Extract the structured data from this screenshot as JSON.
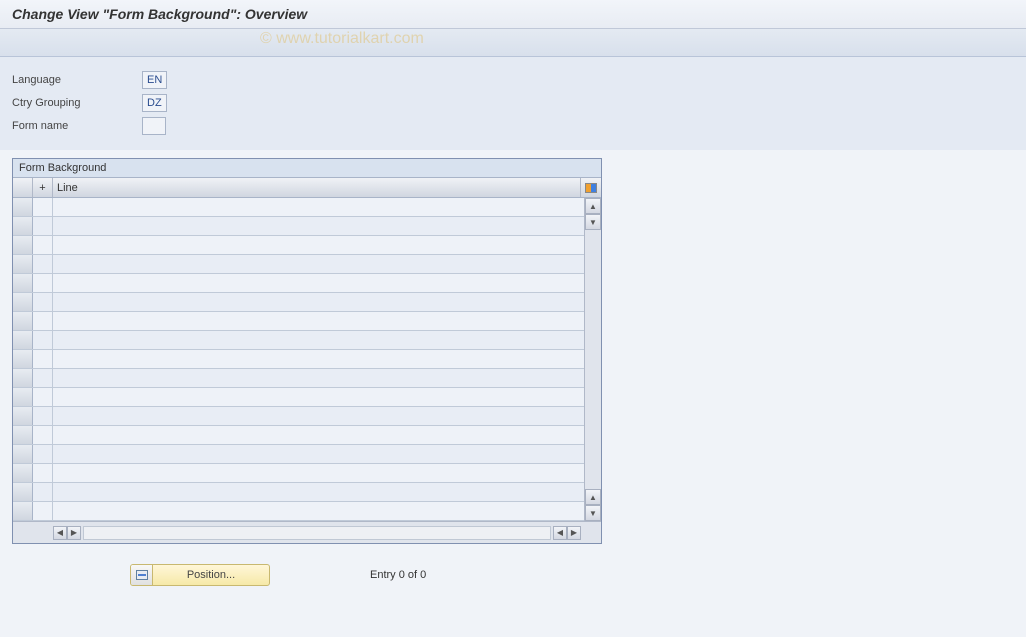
{
  "title": "Change View \"Form Background\": Overview",
  "watermark": "© www.tutorialkart.com",
  "fields": {
    "language_label": "Language",
    "language_value": "EN",
    "ctry_label": "Ctry Grouping",
    "ctry_value": "DZ",
    "formname_label": "Form name",
    "formname_value": ""
  },
  "table": {
    "title": "Form Background",
    "col_plus": "+",
    "col_line": "Line",
    "rows": [
      "",
      "",
      "",
      "",
      "",
      "",
      "",
      "",
      "",
      "",
      "",
      "",
      "",
      "",
      "",
      "",
      ""
    ]
  },
  "position_button": "Position...",
  "entry_status": "Entry 0 of 0",
  "icons": {
    "up": "▲",
    "down": "▼",
    "left": "◀",
    "right": "▶"
  }
}
